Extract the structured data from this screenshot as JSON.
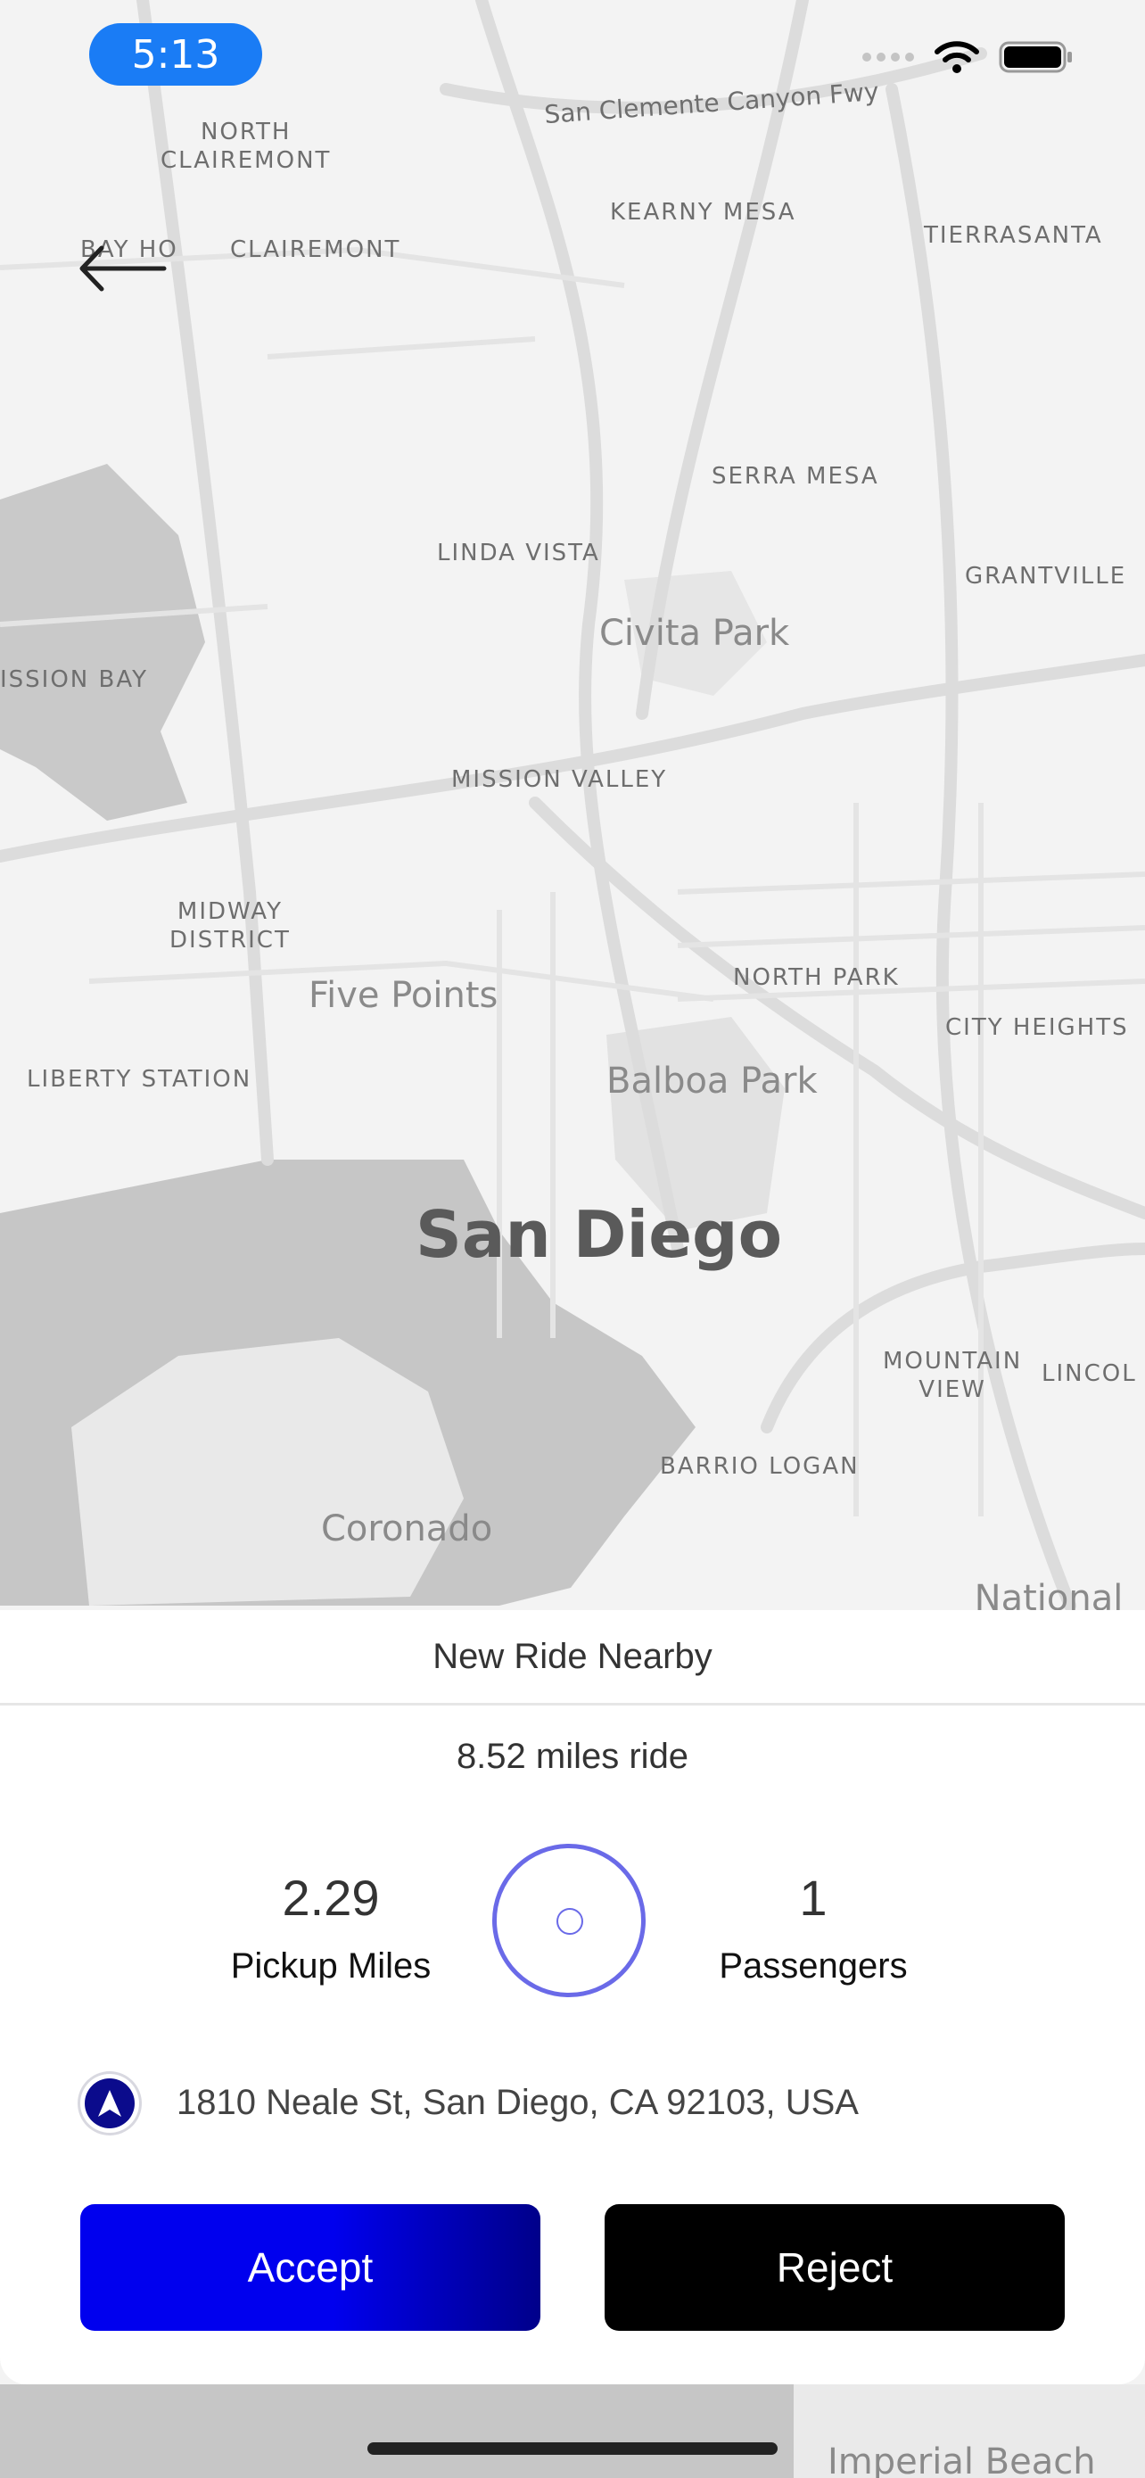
{
  "status_bar": {
    "time": "5:13"
  },
  "map": {
    "labels": {
      "north_clairemont": "NORTH\nCLAIREMONT",
      "clairemont": "CLAIREMONT",
      "bay_ho": "BAY HO",
      "kearny_mesa": "KEARNY MESA",
      "tierrasanta": "TIERRASANTA",
      "freeway": "San Clemente Canyon Fwy",
      "serra_mesa": "SERRA MESA",
      "linda_vista": "LINDA VISTA",
      "grantville": "GRANTVILLE",
      "civita_park": "Civita Park",
      "mission_bay": "ISSION BAY",
      "mission_valley": "MISSION VALLEY",
      "midway_district": "MIDWAY\nDISTRICT",
      "north_park": "NORTH PARK",
      "five_points": "Five Points",
      "city_heights": "CITY HEIGHTS",
      "liberty_station": "LIBERTY STATION",
      "balboa_park": "Balboa Park",
      "san_diego": "San Diego",
      "mountain_view": "MOUNTAIN\nVIEW",
      "lincoln": "LINCOL",
      "barrio_logan": "BARRIO LOGAN",
      "coronado": "Coronado",
      "national_city": "National City",
      "imperial_beach": "Imperial Beach"
    }
  },
  "sheet": {
    "title": "New Ride Nearby",
    "ride_distance": "8.52 miles ride",
    "pickup_miles_value": "2.29",
    "pickup_miles_label": "Pickup Miles",
    "passengers_value": "1",
    "passengers_label": "Passengers",
    "address": "1810 Neale St, San Diego, CA 92103, USA",
    "accept_label": "Accept",
    "reject_label": "Reject"
  },
  "colors": {
    "accent": "#0000ee",
    "ring": "#6a6ae8",
    "status_pill": "#1a7cf5"
  }
}
